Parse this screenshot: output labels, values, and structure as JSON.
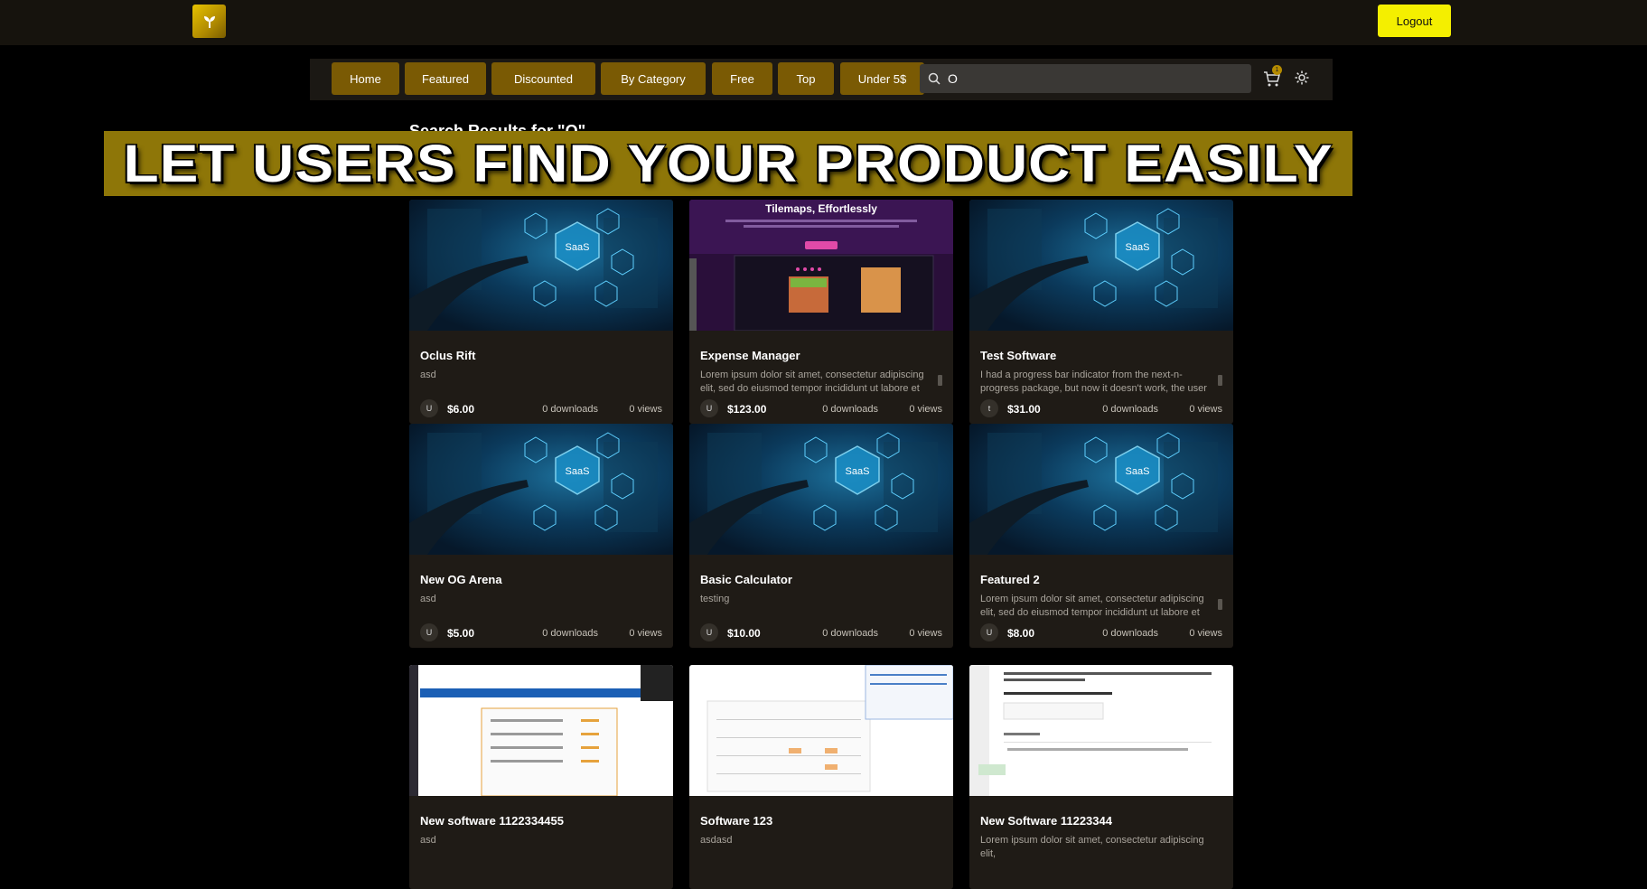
{
  "header": {
    "logo_icon": "plant-sprout-icon",
    "logout_label": "Logout"
  },
  "nav": {
    "items": [
      "Home",
      "Featured",
      "Discounted",
      "By Category",
      "Free",
      "Top",
      "Under 5$"
    ],
    "search_value": "O",
    "cart_count": "1",
    "cart_icon": "cart-icon",
    "settings_icon": "gear-icon",
    "search_icon": "search-icon"
  },
  "page": {
    "results_title": "Search Results for \"O\""
  },
  "banner": {
    "text": "LET USERS FIND YOUR PRODUCT EASILY"
  },
  "thumb_texts": {
    "tilemap_headline": "Tilemaps, Effortlessly"
  },
  "products": [
    {
      "title": "Oclus Rift",
      "description": "asd",
      "avatar": "U",
      "price": "$6.00",
      "downloads": "0 downloads",
      "views": "0 views",
      "thumb": "saas"
    },
    {
      "title": "Expense Manager",
      "description": "Lorem ipsum dolor sit amet, consectetur adipiscing elit, sed do eiusmod tempor incididunt ut labore et dolore magna aliqua.",
      "avatar": "U",
      "price": "$123.00",
      "downloads": "0 downloads",
      "views": "0 views",
      "thumb": "tilemap"
    },
    {
      "title": "Test Software",
      "description": "I had a progress bar indicator from the next-n-progress package, but now it doesn't work, the user clicks on a link",
      "avatar": "t",
      "price": "$31.00",
      "downloads": "0 downloads",
      "views": "0 views",
      "thumb": "saas"
    },
    {
      "title": "New OG Arena",
      "description": "asd",
      "avatar": "U",
      "price": "$5.00",
      "downloads": "0 downloads",
      "views": "0 views",
      "thumb": "saas"
    },
    {
      "title": "Basic Calculator",
      "description": "testing",
      "avatar": "U",
      "price": "$10.00",
      "downloads": "0 downloads",
      "views": "0 views",
      "thumb": "saas"
    },
    {
      "title": "Featured 2",
      "description": "Lorem ipsum dolor sit amet, consectetur adipiscing elit, sed do eiusmod tempor incididunt ut labore et dolore magna aliqua.",
      "avatar": "U",
      "price": "$8.00",
      "downloads": "0 downloads",
      "views": "0 views",
      "thumb": "saas"
    },
    {
      "title": "New software 1122334455",
      "description": "asd",
      "avatar": "",
      "price": "",
      "downloads": "",
      "views": "",
      "thumb": "screenshot1"
    },
    {
      "title": "Software 123",
      "description": "asdasd",
      "avatar": "",
      "price": "",
      "downloads": "",
      "views": "",
      "thumb": "screenshot2"
    },
    {
      "title": "New Software 11223344",
      "description": "Lorem ipsum dolor sit amet, consectetur adipiscing elit,",
      "avatar": "",
      "price": "",
      "downloads": "",
      "views": "",
      "thumb": "screenshot3"
    }
  ],
  "colors": {
    "accent": "#f4ef00",
    "nav_button": "#7a5a04",
    "banner_bg": "#8e7608",
    "card_bg": "#1f1b16"
  }
}
